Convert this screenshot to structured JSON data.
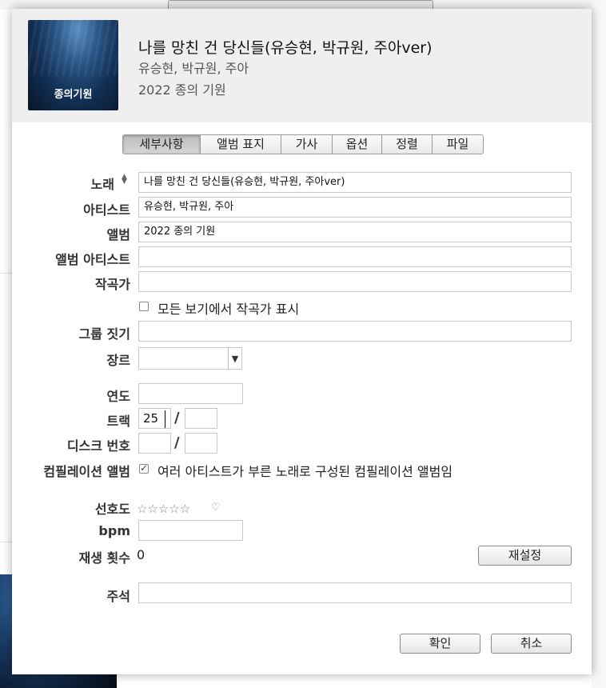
{
  "header": {
    "title": "나를 망친 건 당신들(유승현, 박규원, 주아ver)",
    "artist": "유승현, 박규원, 주아",
    "album": "2022 종의 기원",
    "artwork_text": "종의기원"
  },
  "tabs": [
    {
      "label": "세부사항",
      "active": true
    },
    {
      "label": "앨범 표지",
      "active": false
    },
    {
      "label": "가사",
      "active": false
    },
    {
      "label": "옵션",
      "active": false
    },
    {
      "label": "정렬",
      "active": false
    },
    {
      "label": "파일",
      "active": false
    }
  ],
  "form": {
    "song": {
      "label": "노래",
      "value": "나를 망친 건 당신들(유승현, 박규원, 주아ver)"
    },
    "artist": {
      "label": "아티스트",
      "value": "유승현, 박규원, 주아"
    },
    "album": {
      "label": "앨범",
      "value": "2022 종의 기원"
    },
    "album_artist": {
      "label": "앨범 아티스트",
      "value": ""
    },
    "composer": {
      "label": "작곡가",
      "value": ""
    },
    "show_composer": {
      "label": "모든 보기에서 작곡가 표시",
      "checked": false
    },
    "grouping": {
      "label": "그룹 짓기",
      "value": ""
    },
    "genre": {
      "label": "장르",
      "value": ""
    },
    "year": {
      "label": "연도",
      "value": ""
    },
    "track": {
      "label": "트랙",
      "value": "25",
      "total": ""
    },
    "disc": {
      "label": "디스크 번호",
      "value": "",
      "total": ""
    },
    "compilation": {
      "label": "컴필레이션 앨범",
      "text": "여러 아티스트가 부른 노래로 구성된 컴필레이션 앨범임",
      "checked": true
    },
    "rating": {
      "label": "선호도",
      "stars": "☆☆☆☆☆",
      "heart": "♡",
      "value": 0
    },
    "bpm": {
      "label": "bpm",
      "value": ""
    },
    "play_count": {
      "label": "재생 횟수",
      "value": "0"
    },
    "reset_button": "재설정",
    "comments": {
      "label": "주석",
      "value": ""
    }
  },
  "buttons": {
    "ok": "확인",
    "cancel": "취소"
  },
  "colors": {
    "header_bg": "#efefef",
    "check_color": "#1f3d7a"
  }
}
